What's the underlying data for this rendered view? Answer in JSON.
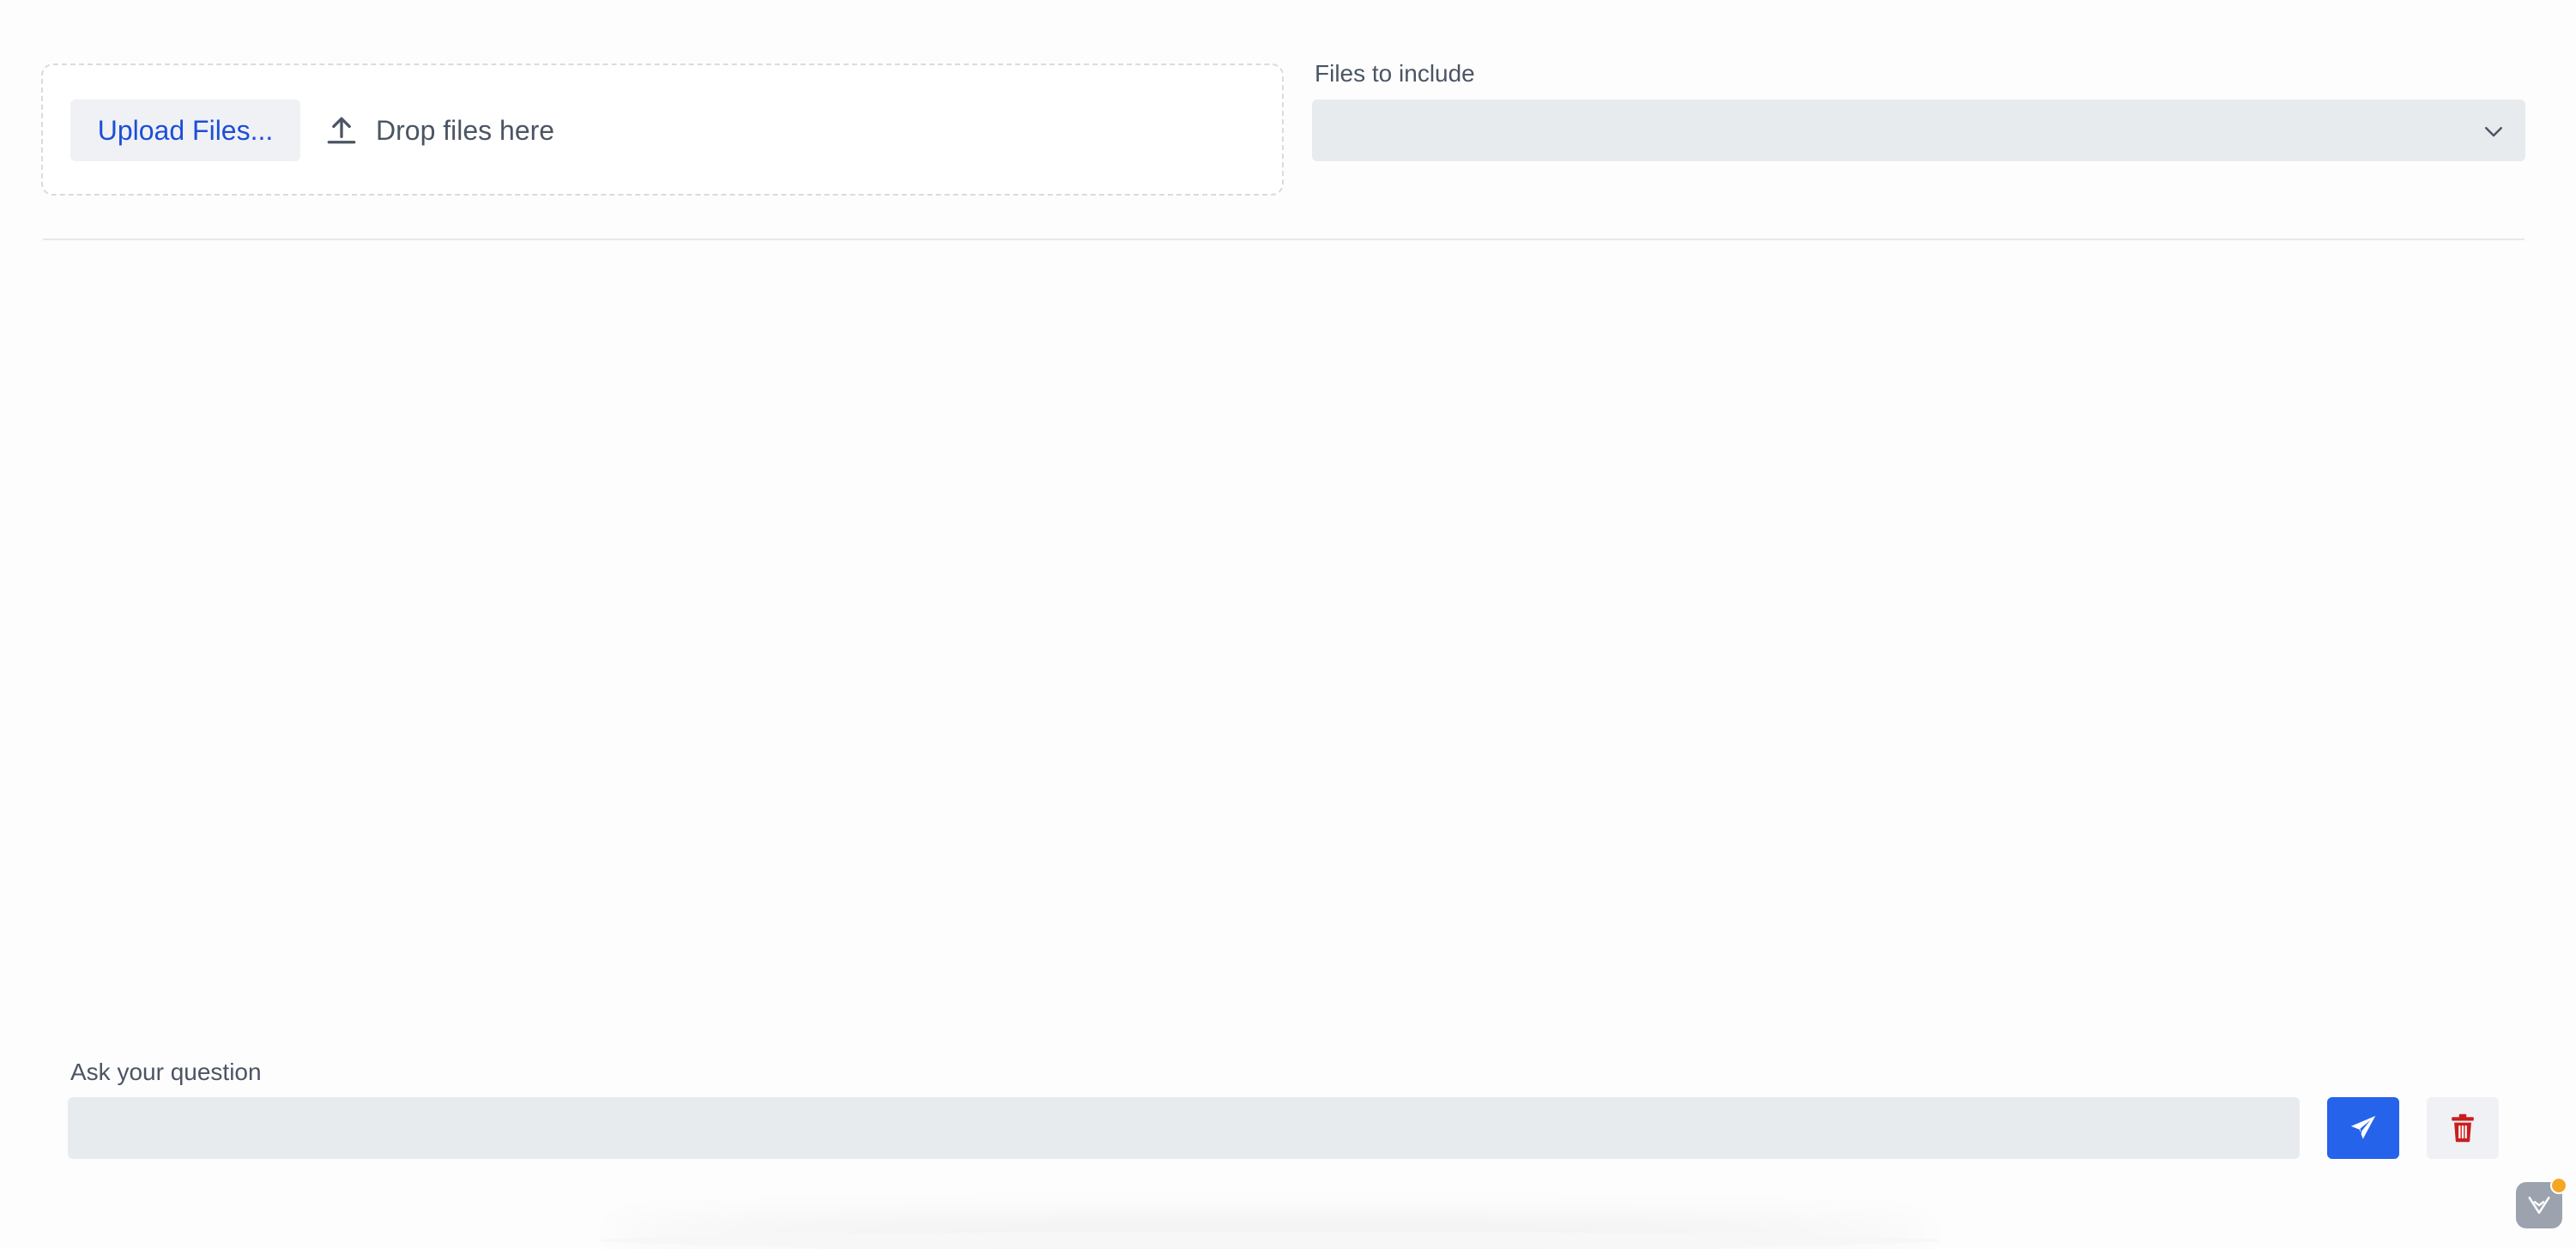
{
  "upload": {
    "button_label": "Upload Files...",
    "drop_hint": "Drop files here",
    "icon": "upload-icon"
  },
  "files_select": {
    "label": "Files to include",
    "value": "",
    "icon": "chevron-down-icon"
  },
  "question": {
    "label": "Ask your question",
    "value": "",
    "send_icon": "paper-plane-icon",
    "clear_icon": "trash-icon"
  },
  "widget": {
    "icon": "chat-widget-icon"
  },
  "colors": {
    "accent": "#2563eb",
    "link_text": "#1d4ed8",
    "danger": "#c81e1e",
    "notification": "#f5a623"
  }
}
